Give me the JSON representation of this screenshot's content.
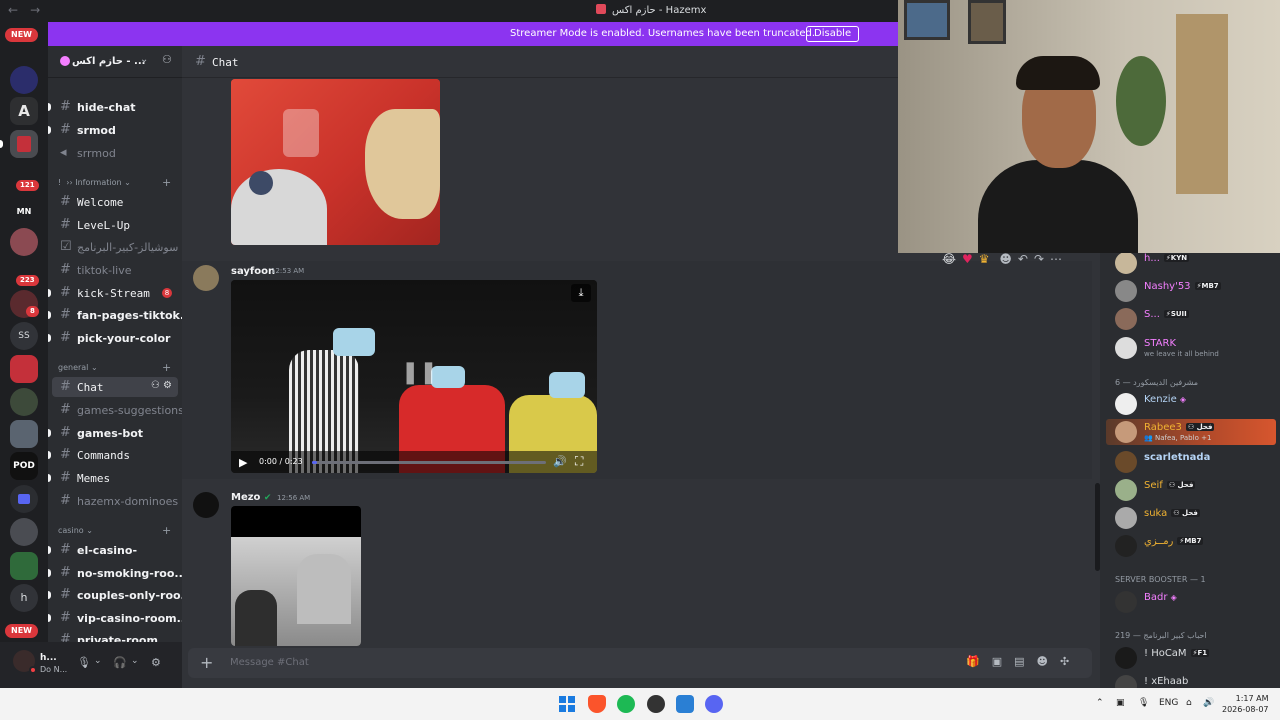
{
  "window": {
    "title": "حازم اكس - Hazemx"
  },
  "banner": {
    "message": "Streamer Mode is enabled. Usernames have been truncated.",
    "button": "Disable"
  },
  "rail": {
    "new_top": "NEW",
    "new_bottom": "NEW",
    "count_1": "121",
    "count_2": "223",
    "count_3": "8",
    "ss_label": "SS",
    "h_label": "h"
  },
  "server": {
    "name": "حازم اكس - ..."
  },
  "channels": {
    "c1": "hide-chat",
    "c2": "srmod",
    "c3": "srrmod",
    "cat_information": "›› Information",
    "c4": "Welcome",
    "c5": "LeveL-Up",
    "c6": "سوشيالز-كبير-البرنامج",
    "c7": "tiktok-live",
    "c8": "kick-Stream",
    "c8_badge": "8",
    "c9": "fan-pages-tiktok...",
    "c10": "pick-your-color",
    "cat_general": "general",
    "c11": "Chat",
    "c12": "games-suggestions",
    "c13": "games-bot",
    "c14": "Commands",
    "c15": "Memes",
    "c16": "hazemx-dominoes",
    "cat_casino": "casino",
    "c17": "el-casino-",
    "c18": "no-smoking-roo...",
    "c19": "couples-only-roo...",
    "c20": "vip-casino-room...",
    "c21": "private-room"
  },
  "user": {
    "name": "h...",
    "status": "Do N..."
  },
  "chat": {
    "channel_name": "Chat",
    "msg1_author": "sayfoon",
    "msg1_time": "12:53 AM",
    "video_time": "0:00 / 0:23",
    "video_progress": 0.02,
    "msg2_author": "Mezo",
    "msg2_time": "12:56 AM",
    "composer_placeholder": "Message #Chat"
  },
  "members": {
    "m1": "h...",
    "m1_tag": "KYN",
    "m2": "Nashy'53",
    "m2_tag": "MB7",
    "m3": "S...",
    "m3_tag": "SUII",
    "m4": "STARK",
    "m4_sub": "we leave it all behind",
    "cat1": "مشرفين الديسكورد — 6",
    "m5": "Kenzie",
    "m6": "Rabee3",
    "m6_tag": "فحل",
    "m6_sub": "Nafea, Pablo +1",
    "m7": "scarletnada",
    "m8": "Seif",
    "m8_tag": "فحل",
    "m9": "suka",
    "m9_tag": "فحل",
    "m10": "رمــزي",
    "m10_tag": "MB7",
    "cat2": "SERVER BOOSTER — 1",
    "m11": "Badr",
    "cat3": "احباب كبير البرنامج — 219",
    "m12": "! HoCaM",
    "m12_tag": "F1",
    "m13": "! xEhaab"
  },
  "taskbar": {
    "lang": "ENG",
    "time": "1:17 AM",
    "date": "2026-08-07"
  }
}
